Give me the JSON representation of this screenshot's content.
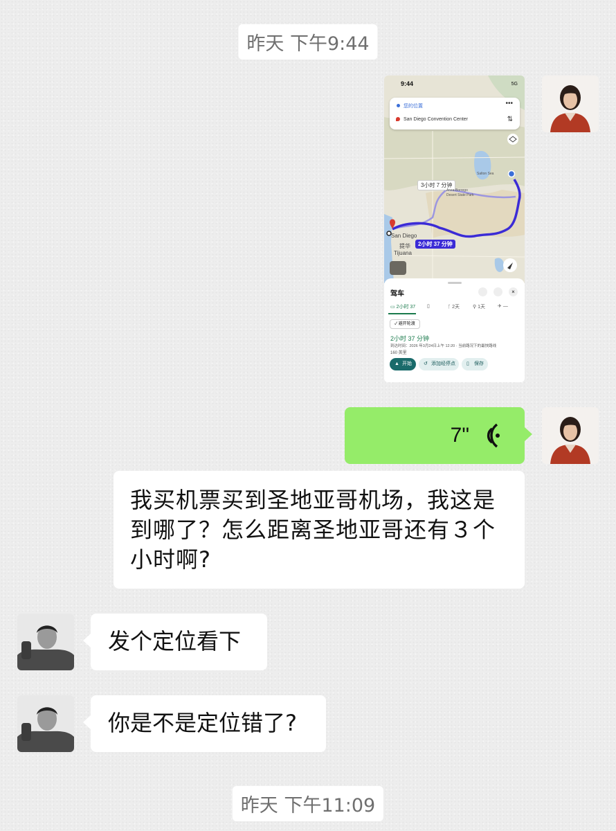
{
  "timestamps": {
    "top": "昨天 下午9:44",
    "bottom": "昨天 下午11:09"
  },
  "messages": {
    "voice_duration": "7\"",
    "question": "我买机票买到圣地亚哥机场，我这是到哪了？怎么距离圣地亚哥还有３个小时啊?",
    "reply1": "发个定位看下",
    "reply2": "你是不是定位错了?"
  },
  "map_screenshot": {
    "time": "9:44",
    "signal": "5G",
    "from": "您的位置",
    "to": "San Diego Convention Center",
    "alt_route": "3小时 7 分钟",
    "main_route": "2小时 37 分钟",
    "place_sd": "San Diego",
    "place_tj_cn": "提华",
    "place_tj": "Tijuana",
    "place_anza": "Anza-Borrego Desert State Park",
    "place_salton": "Salton Sea",
    "mode_title": "驾车",
    "tabs": [
      "2小时 37",
      "",
      "2天",
      "1天",
      "—"
    ],
    "chip": "避开轮渡",
    "duration": "2小时 37 分钟",
    "eta": "到达时间：2026 年3月24日上午 12:20 · 当前路况下的最快路线",
    "distance": "160 英里",
    "btn_start": "开始",
    "btn_add": "添加经停点",
    "btn_save": "保存"
  },
  "colors": {
    "outgoing": "#95ec69",
    "incoming": "#ffffff",
    "route": "#3b2bd6",
    "map_water": "#a9c9e8"
  }
}
